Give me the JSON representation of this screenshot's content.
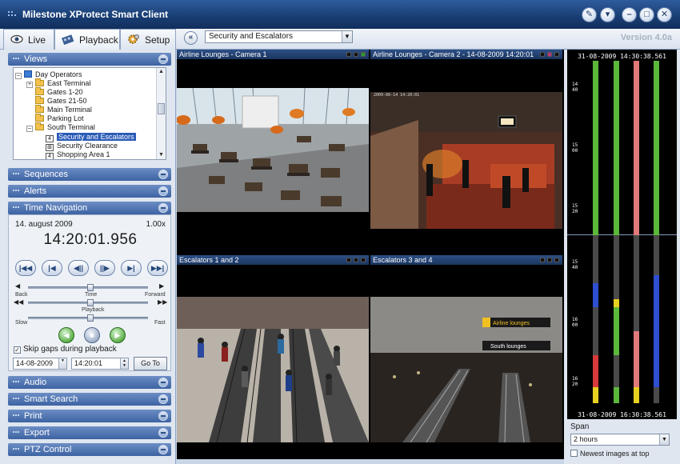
{
  "window": {
    "title": "Milestone XProtect Smart Client",
    "version": "Version 4.0a",
    "buttons": [
      "help-icon",
      "menu-icon",
      "minimize-icon",
      "maximize-icon",
      "close-icon"
    ]
  },
  "tabs": [
    {
      "label": "Live",
      "icon": "eye-icon"
    },
    {
      "label": "Playback",
      "icon": "film-icon"
    },
    {
      "label": "Setup",
      "icon": "gear-icon"
    }
  ],
  "toolbar": {
    "back_glyph": "«",
    "view_selected": "Security and Escalators",
    "dropdown_glyph": "▼"
  },
  "views": {
    "header": "Views",
    "tree": {
      "root": "Day Operators",
      "items": [
        "East Terminal",
        "Gates 1-20",
        "Gates 21-50",
        "Main Terminal",
        "Parking Lot",
        "South Terminal"
      ],
      "sub_items": [
        {
          "badge": "4",
          "label": "Security and Escalators"
        },
        {
          "badge": "",
          "label": "Security Clearance"
        },
        {
          "badge": "4",
          "label": "Shopping Area 1"
        }
      ]
    }
  },
  "sections": {
    "sequences": "Sequences",
    "alerts": "Alerts",
    "time_navigation": "Time Navigation",
    "audio": "Audio",
    "smart_search": "Smart Search",
    "print": "Print",
    "export": "Export",
    "ptz": "PTZ Control"
  },
  "time_nav": {
    "date": "14. august 2009",
    "speed": "1.00x",
    "clock": "14:20:01.956",
    "buttons": [
      "|◀◀",
      "|◀",
      "◀||",
      "||▶",
      "▶|",
      "▶▶|"
    ],
    "slider1": {
      "left": "Back",
      "center": "Time",
      "right": "Forward"
    },
    "slider2": {
      "center": "Playback",
      "left": "Slow",
      "right": "Fast"
    },
    "skip_gaps_label": "Skip gaps during playback",
    "skip_gaps_checked": "✓",
    "date_input": "14-08-2009",
    "time_input": "14:20:01",
    "goto_label": "Go To"
  },
  "cameras": [
    {
      "title": "Airline Lounges - Camera 1"
    },
    {
      "title": "Airline Lounges - Camera 2 - 14-08-2009 14:20:01"
    },
    {
      "title": "Escalators 1 and 2"
    },
    {
      "title": "Escalators 3 and 4"
    }
  ],
  "camera_overlays": {
    "cam2_stamp": "2009-08-14 14:20:01",
    "sign1": "Airline lounges",
    "sign2": "South lounges"
  },
  "timeline": {
    "start_label": "31-08-2009 14:30:38.561",
    "end_label": "31-08-2009 16:30:38.561",
    "ticks_top": [
      "14",
      "40",
      "15",
      "00",
      "15",
      "20"
    ],
    "ticks_bottom": [
      "15",
      "40",
      "16",
      "00",
      "16",
      "20"
    ],
    "span_label": "Span",
    "span_value": "2 hours",
    "newest_label": "Newest images at top",
    "colors": {
      "green": "#5cb83a",
      "red": "#d63a3a",
      "blue": "#2f4fd1",
      "yellow": "#e8d020",
      "gray": "#4a4a4a",
      "pink": "#e07a7a"
    }
  }
}
